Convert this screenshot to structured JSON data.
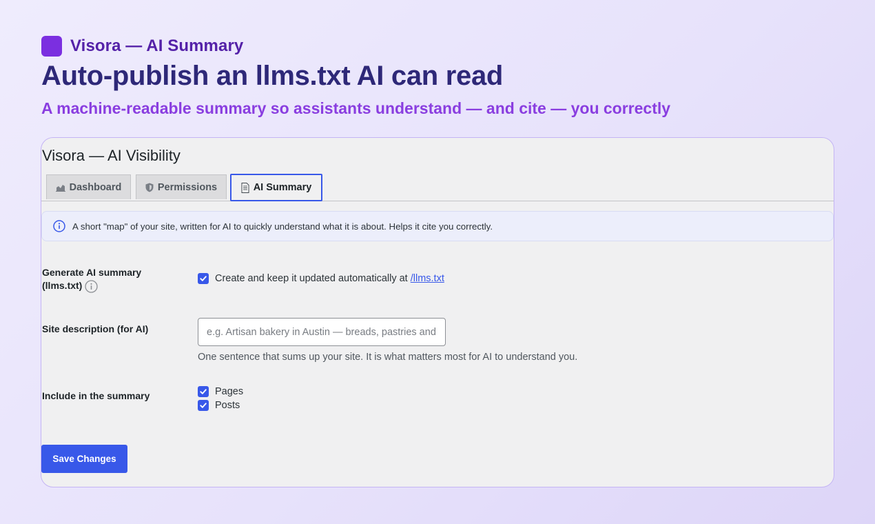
{
  "brand": {
    "name": "Visora — AI Summary",
    "logo_color": "#7b2fe0"
  },
  "headline": "Auto-publish an llms.txt AI can read",
  "subheadline": "A machine-readable summary so assistants understand — and cite — you correctly",
  "panel": {
    "title": "Visora — AI Visibility",
    "tabs": [
      {
        "label": "Dashboard",
        "icon": "chart-icon",
        "active": false
      },
      {
        "label": "Permissions",
        "icon": "shield-icon",
        "active": false
      },
      {
        "label": "AI Summary",
        "icon": "document-icon",
        "active": true
      }
    ],
    "notice": "A short \"map\" of your site, written for AI to quickly understand what it is about. Helps it cite you correctly.",
    "fields": {
      "generate": {
        "label_line1": "Generate AI summary",
        "label_line2": "(llms.txt)",
        "checkbox_text": "Create and keep it updated automatically at",
        "link_text": "/llms.txt",
        "checked": true
      },
      "description": {
        "label": "Site description (for AI)",
        "value": "",
        "placeholder": "e.g. Artisan bakery in Austin — breads, pastries and more",
        "help": "One sentence that sums up your site. It is what matters most for AI to understand you."
      },
      "include": {
        "label": "Include in the summary",
        "options": [
          {
            "label": "Pages",
            "checked": true
          },
          {
            "label": "Posts",
            "checked": true
          }
        ]
      }
    },
    "save_label": "Save Changes"
  },
  "colors": {
    "accent": "#3858e9",
    "headline": "#2e2878",
    "subheadline": "#8a3ee0",
    "brand_text": "#5421a8"
  }
}
